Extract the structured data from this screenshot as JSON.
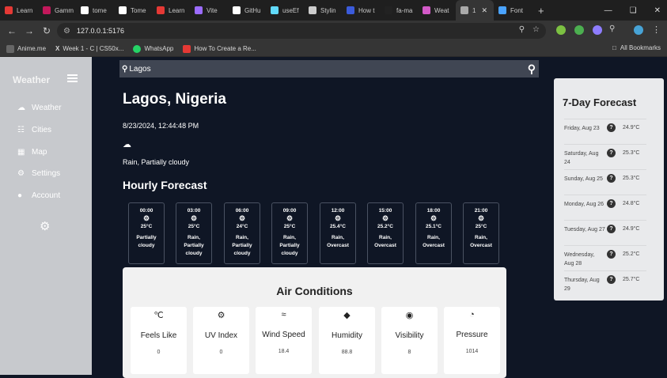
{
  "browser": {
    "tabs": [
      {
        "label": "Learn",
        "color": "#e53935"
      },
      {
        "label": "Gamm",
        "color": "#c2185b"
      },
      {
        "label": "tome",
        "color": "#ffffff"
      },
      {
        "label": "Tome",
        "color": "#ffffff"
      },
      {
        "label": "Learn",
        "color": "#e53935"
      },
      {
        "label": "Vite",
        "color": "#9c6cff"
      },
      {
        "label": "GitHu",
        "color": "#ffffff"
      },
      {
        "label": "useEf",
        "color": "#61dafb"
      },
      {
        "label": "Stylin",
        "color": "#cccccc"
      },
      {
        "label": "How t",
        "color": "#3b5bdb"
      },
      {
        "label": "fa-ma",
        "color": "#222222"
      },
      {
        "label": "Weat",
        "color": "#d35ac8"
      },
      {
        "label": "1",
        "color": "#aaaaaa",
        "active": true
      },
      {
        "label": "Font",
        "color": "#4aa3ff"
      }
    ],
    "url": "127.0.0.1:5176",
    "bookmarks": [
      "Anime.me",
      "Week 1 - C | CS50x...",
      "WhatsApp",
      "How To Create a Re..."
    ],
    "all_bookmarks": "All Bookmarks"
  },
  "sidebar": {
    "brand": "Weather",
    "items": [
      {
        "label": "Weather",
        "icon": "weather-icon"
      },
      {
        "label": "Cities",
        "icon": "cities-icon"
      },
      {
        "label": "Map",
        "icon": "map-icon"
      },
      {
        "label": "Settings",
        "icon": "settings-icon"
      },
      {
        "label": "Account",
        "icon": "account-icon"
      }
    ]
  },
  "search": {
    "value": "Lagos"
  },
  "current": {
    "city": "Lagos, Nigeria",
    "datetime": "8/23/2024, 12:44:48 PM",
    "condition": "Rain, Partially cloudy"
  },
  "hourly": {
    "title": "Hourly Forecast",
    "items": [
      {
        "time": "00:00",
        "temp": "25°C",
        "desc": [
          "Partially",
          "cloudy"
        ]
      },
      {
        "time": "03:00",
        "temp": "25°C",
        "desc": [
          "Rain,",
          "Partially",
          "cloudy"
        ]
      },
      {
        "time": "06:00",
        "temp": "24°C",
        "desc": [
          "Rain,",
          "Partially",
          "cloudy"
        ]
      },
      {
        "time": "09:00",
        "temp": "25°C",
        "desc": [
          "Rain,",
          "Partially",
          "cloudy"
        ]
      },
      {
        "time": "12:00",
        "temp": "25.4°C",
        "desc": [
          "Rain,",
          "Overcast"
        ]
      },
      {
        "time": "15:00",
        "temp": "25.2°C",
        "desc": [
          "Rain,",
          "Overcast"
        ]
      },
      {
        "time": "18:00",
        "temp": "25.1°C",
        "desc": [
          "Rain,",
          "Overcast"
        ]
      },
      {
        "time": "21:00",
        "temp": "25°C",
        "desc": [
          "Rain,",
          "Overcast"
        ]
      }
    ]
  },
  "air": {
    "title": "Air Conditions",
    "items": [
      {
        "label": "Feels Like",
        "value": "0",
        "icon": "thermometer-icon"
      },
      {
        "label": "UV Index",
        "value": "0",
        "icon": "sun-icon"
      },
      {
        "label": "Wind Speed",
        "value": "18.4",
        "icon": "wind-icon"
      },
      {
        "label": "Humidity",
        "value": "88.8",
        "icon": "droplet-icon"
      },
      {
        "label": "Visibility",
        "value": "8",
        "icon": "eye-icon"
      },
      {
        "label": "Pressure",
        "value": "1014",
        "icon": "gauge-icon"
      }
    ]
  },
  "forecast": {
    "title": "7-Day Forecast",
    "items": [
      {
        "day": "Friday, Aug 23",
        "temp": "24.9°C"
      },
      {
        "day": "Saturday, Aug 24",
        "temp": "25.3°C"
      },
      {
        "day": "Sunday, Aug 25",
        "temp": "25.3°C"
      },
      {
        "day": "Monday, Aug 26",
        "temp": "24.8°C"
      },
      {
        "day": "Tuesday, Aug 27",
        "temp": "24.9°C"
      },
      {
        "day": "Wednesday, Aug 28",
        "temp": "25.2°C"
      },
      {
        "day": "Thursday, Aug 29",
        "temp": "25.7°C"
      }
    ]
  }
}
